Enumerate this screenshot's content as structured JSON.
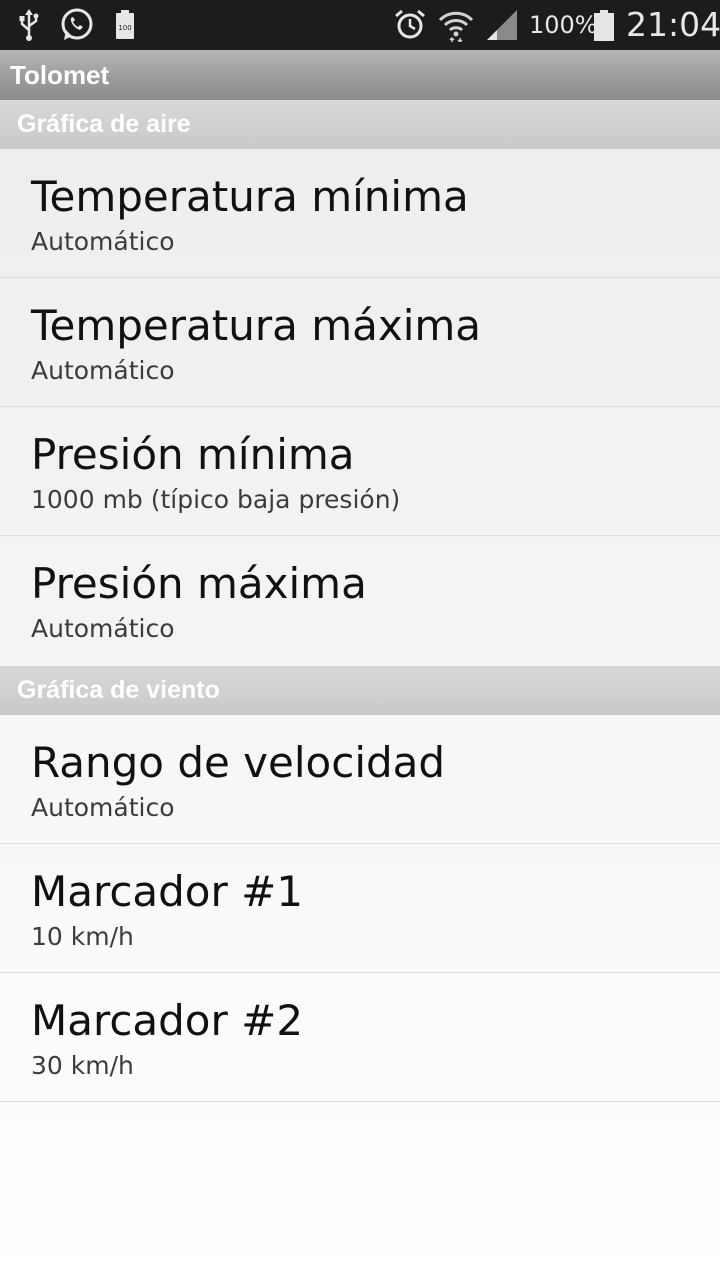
{
  "status_bar": {
    "icons": [
      "usb-icon",
      "whatsapp-icon",
      "battery-full-notification-icon",
      "alarm-icon",
      "wifi-icon",
      "signal-icon",
      "battery-icon"
    ],
    "notification_battery_label": "100",
    "battery_percent": "100%",
    "time": "21:04"
  },
  "app": {
    "title": "Tolomet"
  },
  "sections": [
    {
      "header": "Gráfica de aire",
      "items": [
        {
          "title": "Temperatura mínima",
          "summary": "Automático"
        },
        {
          "title": "Temperatura máxima",
          "summary": "Automático"
        },
        {
          "title": "Presión mínima",
          "summary": "1000 mb (típico baja presión)"
        },
        {
          "title": "Presión máxima",
          "summary": "Automático"
        }
      ]
    },
    {
      "header": "Gráfica de viento",
      "items": [
        {
          "title": "Rango de velocidad",
          "summary": "Automático"
        },
        {
          "title": "Marcador #1",
          "summary": "10 km/h"
        },
        {
          "title": "Marcador #2",
          "summary": "30 km/h"
        }
      ]
    }
  ]
}
